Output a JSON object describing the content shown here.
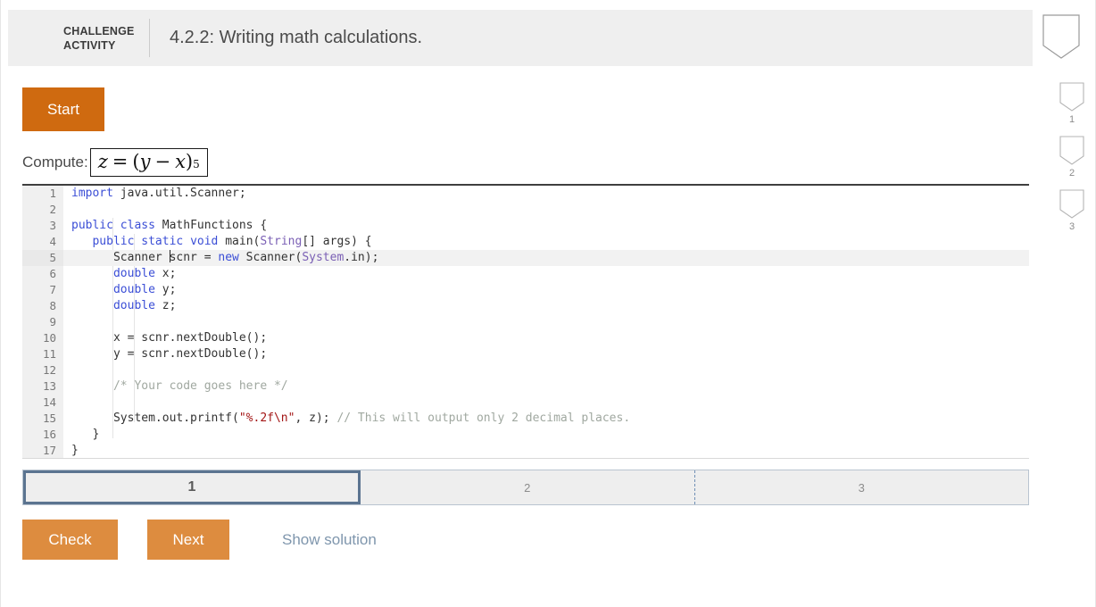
{
  "header": {
    "kicker_line1": "CHALLENGE",
    "kicker_line2": "ACTIVITY",
    "title": "4.2.2: Writing math calculations.",
    "accent_color": "#1f8ecd"
  },
  "badges": {
    "top_label": "",
    "items": [
      {
        "label": "1"
      },
      {
        "label": "2"
      },
      {
        "label": "3"
      }
    ]
  },
  "start": {
    "label": "Start",
    "color": "#cf6a10"
  },
  "prompt": {
    "label": "Compute:",
    "formula": {
      "lhs": "z",
      "equals": "=",
      "open": "(",
      "var1": "y",
      "minus": "−",
      "var2": "x",
      "close": ")",
      "exponent": "5",
      "plain": "z = (y − x)^5"
    }
  },
  "editor": {
    "language": "java",
    "active_line": 5,
    "lines": [
      {
        "n": "1",
        "segments": [
          {
            "t": "import",
            "c": "kw"
          },
          {
            "t": " java.util.Scanner;",
            "c": ""
          }
        ]
      },
      {
        "n": "2",
        "segments": [
          {
            "t": "",
            "c": ""
          }
        ]
      },
      {
        "n": "3",
        "segments": [
          {
            "t": "public",
            "c": "kw"
          },
          {
            "t": " ",
            "c": ""
          },
          {
            "t": "class",
            "c": "kw"
          },
          {
            "t": " MathFunctions {",
            "c": ""
          }
        ]
      },
      {
        "n": "4",
        "segments": [
          {
            "t": "   ",
            "c": ""
          },
          {
            "t": "public",
            "c": "kw"
          },
          {
            "t": " ",
            "c": ""
          },
          {
            "t": "static",
            "c": "kw"
          },
          {
            "t": " ",
            "c": ""
          },
          {
            "t": "void",
            "c": "kw"
          },
          {
            "t": " main(",
            "c": ""
          },
          {
            "t": "String",
            "c": "typ"
          },
          {
            "t": "[] args) {",
            "c": ""
          }
        ]
      },
      {
        "n": "5",
        "segments": [
          {
            "t": "      Scanner ",
            "c": ""
          },
          {
            "t": "|",
            "c": "caret"
          },
          {
            "t": "scnr = ",
            "c": ""
          },
          {
            "t": "new",
            "c": "kw"
          },
          {
            "t": " Scanner(",
            "c": ""
          },
          {
            "t": "System",
            "c": "typ"
          },
          {
            "t": ".in);",
            "c": ""
          }
        ]
      },
      {
        "n": "6",
        "segments": [
          {
            "t": "      ",
            "c": ""
          },
          {
            "t": "double",
            "c": "kw"
          },
          {
            "t": " x;",
            "c": ""
          }
        ]
      },
      {
        "n": "7",
        "segments": [
          {
            "t": "      ",
            "c": ""
          },
          {
            "t": "double",
            "c": "kw"
          },
          {
            "t": " y;",
            "c": ""
          }
        ]
      },
      {
        "n": "8",
        "segments": [
          {
            "t": "      ",
            "c": ""
          },
          {
            "t": "double",
            "c": "kw"
          },
          {
            "t": " z;",
            "c": ""
          }
        ]
      },
      {
        "n": "9",
        "segments": [
          {
            "t": "",
            "c": ""
          }
        ]
      },
      {
        "n": "10",
        "segments": [
          {
            "t": "      x = scnr.nextDouble();",
            "c": ""
          }
        ]
      },
      {
        "n": "11",
        "segments": [
          {
            "t": "      y = scnr.nextDouble();",
            "c": ""
          }
        ]
      },
      {
        "n": "12",
        "segments": [
          {
            "t": "",
            "c": ""
          }
        ]
      },
      {
        "n": "13",
        "segments": [
          {
            "t": "      ",
            "c": ""
          },
          {
            "t": "/* Your code goes here */",
            "c": "cmt"
          }
        ]
      },
      {
        "n": "14",
        "segments": [
          {
            "t": "",
            "c": ""
          }
        ]
      },
      {
        "n": "15",
        "segments": [
          {
            "t": "      System.out.printf(",
            "c": ""
          },
          {
            "t": "\"%.2f\\n\"",
            "c": "str"
          },
          {
            "t": ", z); ",
            "c": ""
          },
          {
            "t": "// This will output only 2 decimal places.",
            "c": "cmt"
          }
        ]
      },
      {
        "n": "16",
        "segments": [
          {
            "t": "   }",
            "c": ""
          }
        ]
      },
      {
        "n": "17",
        "segments": [
          {
            "t": "}",
            "c": ""
          }
        ]
      }
    ]
  },
  "tabs": {
    "active_index": 0,
    "items": [
      {
        "label": "1",
        "active": true
      },
      {
        "label": "2",
        "active": false
      },
      {
        "label": "3",
        "active": false
      }
    ]
  },
  "footer": {
    "check_label": "Check",
    "next_label": "Next",
    "show_solution_label": "Show solution",
    "button_color": "#dd8c3f",
    "link_color": "#7f96ad"
  }
}
